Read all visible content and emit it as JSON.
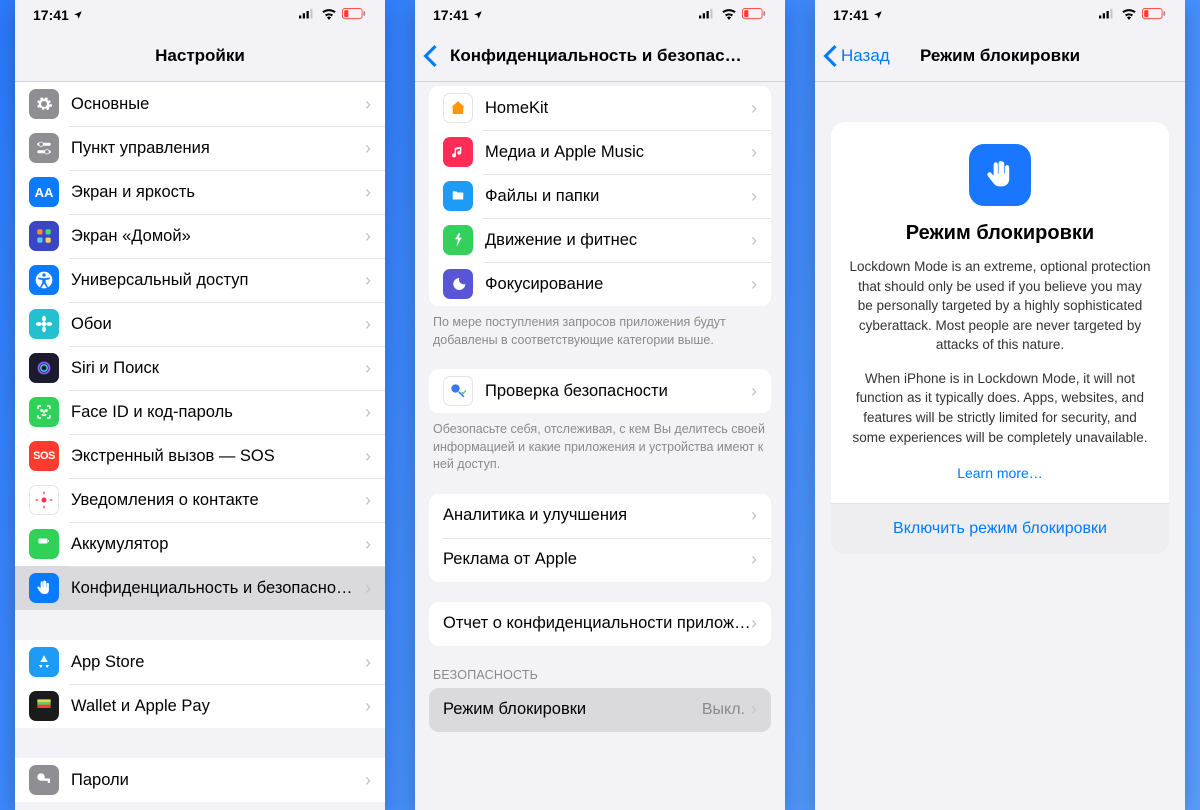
{
  "status": {
    "time": "17:41",
    "location_icon": "▸",
    "signal": "⁚⁚┃",
    "wifi": "wifi",
    "battery": "low"
  },
  "screen1": {
    "title": "Настройки",
    "items": [
      {
        "label": "Основные",
        "icon_bg": "#8e8e93",
        "icon": "gear"
      },
      {
        "label": "Пункт управления",
        "icon_bg": "#8e8e93",
        "icon": "switches"
      },
      {
        "label": "Экран и яркость",
        "icon_bg": "#0a7aff",
        "icon": "AA"
      },
      {
        "label": "Экран «Домой»",
        "icon_bg": "#3b46c7",
        "icon": "grid"
      },
      {
        "label": "Универсальный доступ",
        "icon_bg": "#0a7aff",
        "icon": "accessibility"
      },
      {
        "label": "Обои",
        "icon_bg": "#24c0cf",
        "icon": "flower"
      },
      {
        "label": "Siri и Поиск",
        "icon_bg": "#1b1b2d",
        "icon": "siri"
      },
      {
        "label": "Face ID и код-пароль",
        "icon_bg": "#30d158",
        "icon": "faceid"
      },
      {
        "label": "Экстренный вызов — SOS",
        "icon_bg": "#ff3b30",
        "icon": "SOS"
      },
      {
        "label": "Уведомления о контакте",
        "icon_bg": "#ffffff",
        "icon": "exposure"
      },
      {
        "label": "Аккумулятор",
        "icon_bg": "#30d158",
        "icon": "battery"
      },
      {
        "label": "Конфиденциальность и безопасно…",
        "icon_bg": "#0a7aff",
        "icon": "hand",
        "selected": true
      }
    ],
    "items2": [
      {
        "label": "App Store",
        "icon_bg": "#1e9bf5",
        "icon": "appstore"
      },
      {
        "label": "Wallet и Apple Pay",
        "icon_bg": "#1b1b1b",
        "icon": "wallet"
      }
    ],
    "items3": [
      {
        "label": "Пароли",
        "icon_bg": "#8e8e93",
        "icon": "key"
      }
    ]
  },
  "screen2": {
    "title": "Конфиденциальность и безопасно…",
    "group1": [
      {
        "label": "HomeKit",
        "icon_bg": "#ffffff",
        "icon": "home"
      },
      {
        "label": "Медиа и Apple Music",
        "icon_bg": "#ff2d55",
        "icon": "music"
      },
      {
        "label": "Файлы и папки",
        "icon_bg": "#1e9bf5",
        "icon": "folder"
      },
      {
        "label": "Движение и фитнес",
        "icon_bg": "#33d15b",
        "icon": "fitness"
      },
      {
        "label": "Фокусирование",
        "icon_bg": "#5856d6",
        "icon": "moon"
      }
    ],
    "group1_footer": "По мере поступления запросов приложения будут добавлены в соответствующие категории выше.",
    "group2": [
      {
        "label": "Проверка безопасности",
        "icon_bg": "#ffffff",
        "icon": "safetycheck"
      }
    ],
    "group2_footer": "Обезопасьте себя, отслеживая, с кем Вы делитесь своей информацией и какие приложения и устройства имеют к ней доступ.",
    "group3": [
      {
        "label": "Аналитика и улучшения"
      },
      {
        "label": "Реклама от Apple"
      }
    ],
    "group4": [
      {
        "label": "Отчет о конфиденциальности приложений"
      }
    ],
    "section_header": "БЕЗОПАСНОСТЬ",
    "group5": [
      {
        "label": "Режим блокировки",
        "value": "Выкл.",
        "selected": true
      }
    ]
  },
  "screen3": {
    "back": "Назад",
    "title": "Режим блокировки",
    "card_title": "Режим блокировки",
    "para1": "Lockdown Mode is an extreme, optional protection that should only be used if you believe you may be personally targeted by a highly sophisticated cyberattack. Most people are never targeted by attacks of this nature.",
    "para2": "When iPhone is in Lockdown Mode, it will not function as it typically does. Apps, websites, and features will be strictly limited for security, and some experiences will be completely unavailable.",
    "learn_more": "Learn more…",
    "action": "Включить режим блокировки"
  }
}
